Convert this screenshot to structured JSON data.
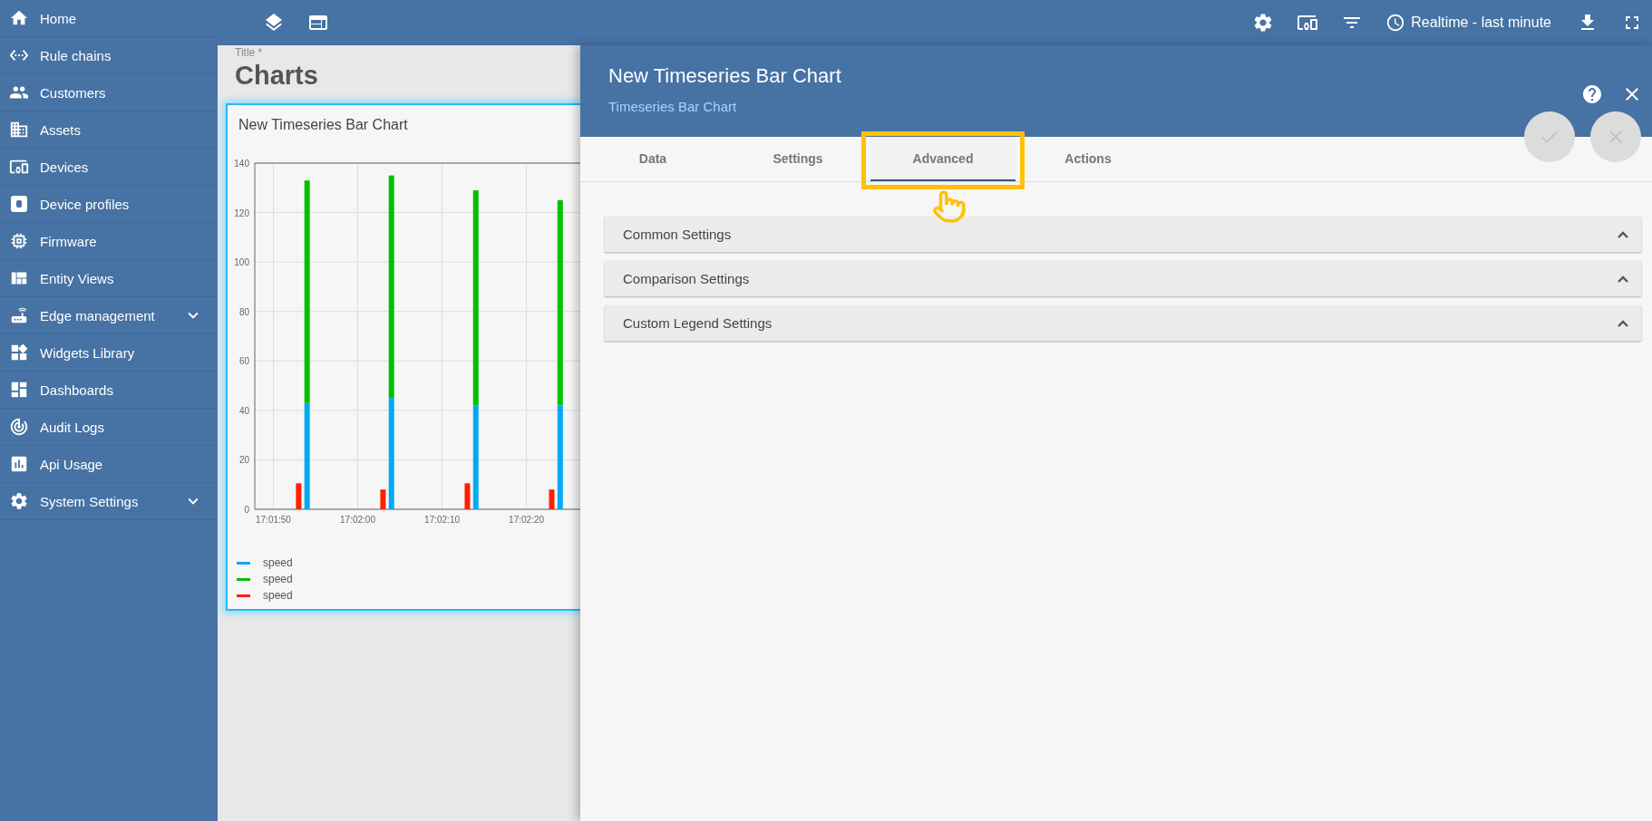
{
  "sidebar": {
    "items": [
      {
        "label": "Home",
        "kind": "link"
      },
      {
        "label": "Rule chains",
        "kind": "link"
      },
      {
        "label": "Customers",
        "kind": "link"
      },
      {
        "label": "Assets",
        "kind": "link"
      },
      {
        "label": "Devices",
        "kind": "link"
      },
      {
        "label": "Device profiles",
        "kind": "link"
      },
      {
        "label": "Firmware",
        "kind": "link"
      },
      {
        "label": "Entity Views",
        "kind": "link"
      },
      {
        "label": "Edge management",
        "kind": "group"
      },
      {
        "label": "Widgets Library",
        "kind": "link"
      },
      {
        "label": "Dashboards",
        "kind": "link"
      },
      {
        "label": "Audit Logs",
        "kind": "link"
      },
      {
        "label": "Api Usage",
        "kind": "link"
      },
      {
        "label": "System Settings",
        "kind": "group"
      }
    ]
  },
  "toolbar": {
    "timewindow": "Realtime - last minute"
  },
  "dashboard": {
    "title_label": "Title *",
    "title": "Charts",
    "widget": {
      "title": "New Timeseries Bar Chart",
      "chart_data": {
        "type": "bar",
        "stacked": true,
        "grid": true,
        "ylim": [
          0,
          140
        ],
        "categories": [
          "17:01:50",
          null,
          null,
          null,
          null,
          null,
          null,
          null,
          null,
          null,
          "17:02:00",
          null,
          null,
          null,
          null,
          null,
          null,
          null,
          null,
          null,
          "17:02:10",
          null,
          null,
          null,
          null,
          null,
          null,
          null,
          null,
          null,
          "17:02:20",
          null,
          null,
          null,
          null,
          null,
          null
        ],
        "yticks": [
          0,
          20,
          40,
          60,
          80,
          100,
          120,
          140
        ],
        "series": [
          {
            "name": "speed",
            "color": "#03a9f4",
            "values": [
              null,
              null,
              null,
              null,
              43,
              null,
              null,
              null,
              null,
              null,
              null,
              null,
              null,
              null,
              45,
              null,
              null,
              null,
              null,
              null,
              null,
              null,
              null,
              null,
              42,
              null,
              null,
              null,
              null,
              null,
              null,
              null,
              null,
              null,
              42,
              null,
              null
            ]
          },
          {
            "name": "speed",
            "color": "#00c000",
            "values": [
              null,
              null,
              null,
              null,
              90,
              null,
              null,
              null,
              null,
              null,
              null,
              null,
              null,
              null,
              90,
              null,
              null,
              null,
              null,
              null,
              null,
              null,
              null,
              null,
              87,
              null,
              null,
              null,
              null,
              null,
              null,
              null,
              null,
              null,
              83,
              null,
              null
            ]
          },
          {
            "name": "speed",
            "color": "#ff2000",
            "values": [
              null,
              null,
              null,
              10.5,
              null,
              null,
              null,
              null,
              null,
              null,
              null,
              null,
              null,
              8,
              null,
              null,
              null,
              null,
              null,
              null,
              null,
              null,
              null,
              10.5,
              null,
              null,
              null,
              null,
              null,
              null,
              null,
              null,
              null,
              8,
              null,
              null,
              null
            ]
          }
        ]
      }
    }
  },
  "panel": {
    "title": "New Timeseries Bar Chart",
    "subtitle": "Timeseries Bar Chart",
    "tabs": [
      {
        "label": "Data",
        "selected": false
      },
      {
        "label": "Settings",
        "selected": false
      },
      {
        "label": "Advanced",
        "selected": true
      },
      {
        "label": "Actions",
        "selected": false
      }
    ],
    "sections": [
      {
        "label": "Common Settings",
        "expanded": false
      },
      {
        "label": "Comparison Settings",
        "expanded": false
      },
      {
        "label": "Custom Legend Settings",
        "expanded": false
      }
    ]
  }
}
